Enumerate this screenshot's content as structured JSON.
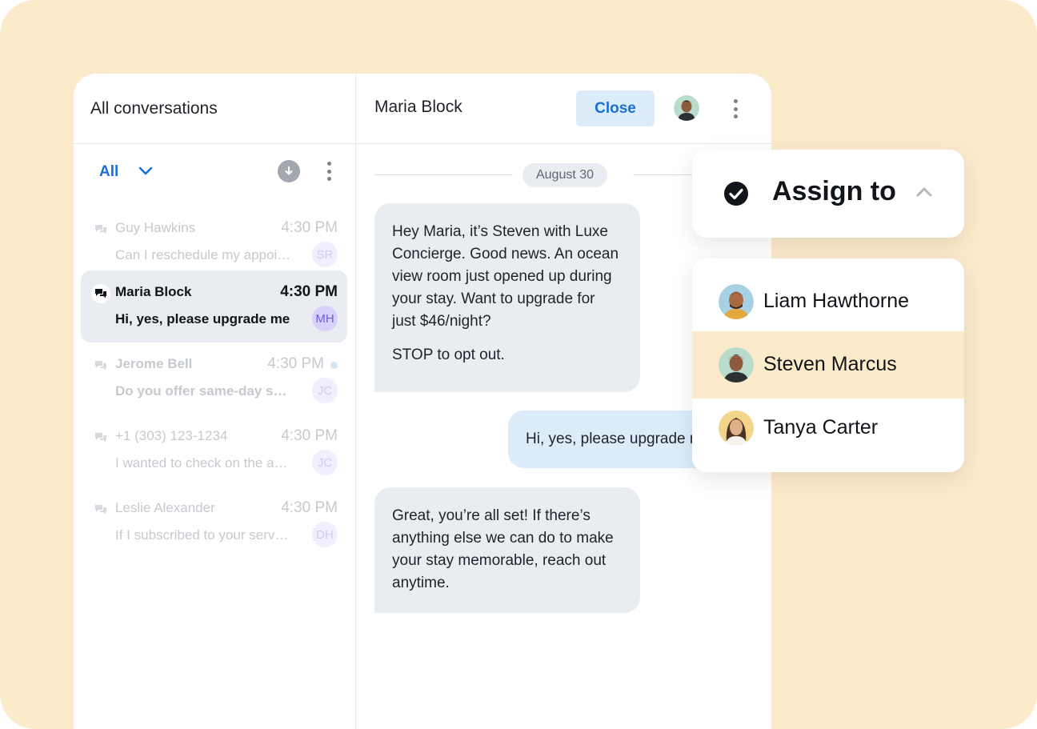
{
  "conversations_panel": {
    "title": "All conversations",
    "filter_label": "All",
    "items": [
      {
        "name": "Guy Hawkins",
        "time": "4:30 PM",
        "preview": "Can I reschedule my appoi…",
        "initials": "SR"
      },
      {
        "name": "Maria Block",
        "time": "4:30 PM",
        "preview": "Hi, yes, please upgrade me",
        "initials": "MH"
      },
      {
        "name": "Jerome Bell",
        "time": "4:30 PM",
        "preview": "Do you offer same-day s…",
        "initials": "JC"
      },
      {
        "name": "+1 (303) 123-1234",
        "time": "4:30 PM",
        "preview": "I wanted to check on the a…",
        "initials": "JC"
      },
      {
        "name": "Leslie Alexander",
        "time": "4:30 PM",
        "preview": "If I subscribed to your serv…",
        "initials": "DH"
      }
    ]
  },
  "chat": {
    "contact_name": "Maria Block",
    "close_label": "Close",
    "date_label": "August 30",
    "messages": [
      {
        "direction": "incoming",
        "line1": "Hey Maria, it’s Steven with Luxe Concierge. Good news. An ocean view room just opened up during your stay. Want to upgrade for just $46/night?",
        "line2": "STOP to opt out."
      },
      {
        "direction": "outgoing",
        "text": "Hi, yes, please upgrade me"
      },
      {
        "direction": "incoming",
        "text": "Great, you’re all set! If there’s anything else we can do to make your stay memorable, reach out anytime."
      }
    ]
  },
  "assign": {
    "label": "Assign to",
    "agents": [
      {
        "name": "Liam Hawthorne"
      },
      {
        "name": "Steven Marcus",
        "selected": true
      },
      {
        "name": "Tanya Carter"
      }
    ]
  },
  "colors": {
    "backdrop": "#fcebcb",
    "accent_blue": "#1a6fd6",
    "incoming_bubble": "#e9edf1",
    "outgoing_bubble": "#dcecfa",
    "selected_agent": "#fcebcb"
  },
  "icons": [
    "chevron-down-icon",
    "download-icon",
    "more-vertical-icon",
    "chat-bubbles-icon",
    "check-circle-icon",
    "chevron-up-icon"
  ]
}
